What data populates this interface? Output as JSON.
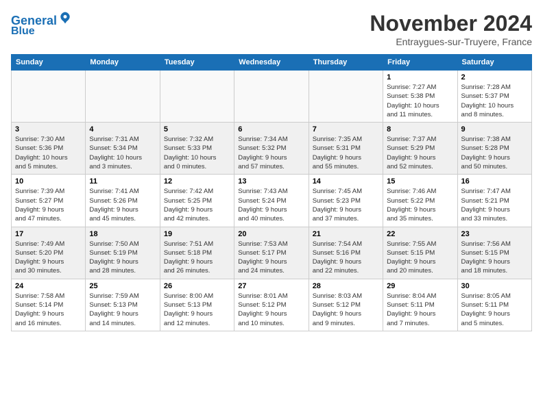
{
  "header": {
    "logo_line1": "General",
    "logo_line2": "Blue",
    "month_title": "November 2024",
    "subtitle": "Entraygues-sur-Truyere, France"
  },
  "days_of_week": [
    "Sunday",
    "Monday",
    "Tuesday",
    "Wednesday",
    "Thursday",
    "Friday",
    "Saturday"
  ],
  "weeks": [
    {
      "days": [
        {
          "num": "",
          "info": ""
        },
        {
          "num": "",
          "info": ""
        },
        {
          "num": "",
          "info": ""
        },
        {
          "num": "",
          "info": ""
        },
        {
          "num": "",
          "info": ""
        },
        {
          "num": "1",
          "info": "Sunrise: 7:27 AM\nSunset: 5:38 PM\nDaylight: 10 hours\nand 11 minutes."
        },
        {
          "num": "2",
          "info": "Sunrise: 7:28 AM\nSunset: 5:37 PM\nDaylight: 10 hours\nand 8 minutes."
        }
      ]
    },
    {
      "days": [
        {
          "num": "3",
          "info": "Sunrise: 7:30 AM\nSunset: 5:36 PM\nDaylight: 10 hours\nand 5 minutes."
        },
        {
          "num": "4",
          "info": "Sunrise: 7:31 AM\nSunset: 5:34 PM\nDaylight: 10 hours\nand 3 minutes."
        },
        {
          "num": "5",
          "info": "Sunrise: 7:32 AM\nSunset: 5:33 PM\nDaylight: 10 hours\nand 0 minutes."
        },
        {
          "num": "6",
          "info": "Sunrise: 7:34 AM\nSunset: 5:32 PM\nDaylight: 9 hours\nand 57 minutes."
        },
        {
          "num": "7",
          "info": "Sunrise: 7:35 AM\nSunset: 5:31 PM\nDaylight: 9 hours\nand 55 minutes."
        },
        {
          "num": "8",
          "info": "Sunrise: 7:37 AM\nSunset: 5:29 PM\nDaylight: 9 hours\nand 52 minutes."
        },
        {
          "num": "9",
          "info": "Sunrise: 7:38 AM\nSunset: 5:28 PM\nDaylight: 9 hours\nand 50 minutes."
        }
      ]
    },
    {
      "days": [
        {
          "num": "10",
          "info": "Sunrise: 7:39 AM\nSunset: 5:27 PM\nDaylight: 9 hours\nand 47 minutes."
        },
        {
          "num": "11",
          "info": "Sunrise: 7:41 AM\nSunset: 5:26 PM\nDaylight: 9 hours\nand 45 minutes."
        },
        {
          "num": "12",
          "info": "Sunrise: 7:42 AM\nSunset: 5:25 PM\nDaylight: 9 hours\nand 42 minutes."
        },
        {
          "num": "13",
          "info": "Sunrise: 7:43 AM\nSunset: 5:24 PM\nDaylight: 9 hours\nand 40 minutes."
        },
        {
          "num": "14",
          "info": "Sunrise: 7:45 AM\nSunset: 5:23 PM\nDaylight: 9 hours\nand 37 minutes."
        },
        {
          "num": "15",
          "info": "Sunrise: 7:46 AM\nSunset: 5:22 PM\nDaylight: 9 hours\nand 35 minutes."
        },
        {
          "num": "16",
          "info": "Sunrise: 7:47 AM\nSunset: 5:21 PM\nDaylight: 9 hours\nand 33 minutes."
        }
      ]
    },
    {
      "days": [
        {
          "num": "17",
          "info": "Sunrise: 7:49 AM\nSunset: 5:20 PM\nDaylight: 9 hours\nand 30 minutes."
        },
        {
          "num": "18",
          "info": "Sunrise: 7:50 AM\nSunset: 5:19 PM\nDaylight: 9 hours\nand 28 minutes."
        },
        {
          "num": "19",
          "info": "Sunrise: 7:51 AM\nSunset: 5:18 PM\nDaylight: 9 hours\nand 26 minutes."
        },
        {
          "num": "20",
          "info": "Sunrise: 7:53 AM\nSunset: 5:17 PM\nDaylight: 9 hours\nand 24 minutes."
        },
        {
          "num": "21",
          "info": "Sunrise: 7:54 AM\nSunset: 5:16 PM\nDaylight: 9 hours\nand 22 minutes."
        },
        {
          "num": "22",
          "info": "Sunrise: 7:55 AM\nSunset: 5:15 PM\nDaylight: 9 hours\nand 20 minutes."
        },
        {
          "num": "23",
          "info": "Sunrise: 7:56 AM\nSunset: 5:15 PM\nDaylight: 9 hours\nand 18 minutes."
        }
      ]
    },
    {
      "days": [
        {
          "num": "24",
          "info": "Sunrise: 7:58 AM\nSunset: 5:14 PM\nDaylight: 9 hours\nand 16 minutes."
        },
        {
          "num": "25",
          "info": "Sunrise: 7:59 AM\nSunset: 5:13 PM\nDaylight: 9 hours\nand 14 minutes."
        },
        {
          "num": "26",
          "info": "Sunrise: 8:00 AM\nSunset: 5:13 PM\nDaylight: 9 hours\nand 12 minutes."
        },
        {
          "num": "27",
          "info": "Sunrise: 8:01 AM\nSunset: 5:12 PM\nDaylight: 9 hours\nand 10 minutes."
        },
        {
          "num": "28",
          "info": "Sunrise: 8:03 AM\nSunset: 5:12 PM\nDaylight: 9 hours\nand 9 minutes."
        },
        {
          "num": "29",
          "info": "Sunrise: 8:04 AM\nSunset: 5:11 PM\nDaylight: 9 hours\nand 7 minutes."
        },
        {
          "num": "30",
          "info": "Sunrise: 8:05 AM\nSunset: 5:11 PM\nDaylight: 9 hours\nand 5 minutes."
        }
      ]
    }
  ]
}
